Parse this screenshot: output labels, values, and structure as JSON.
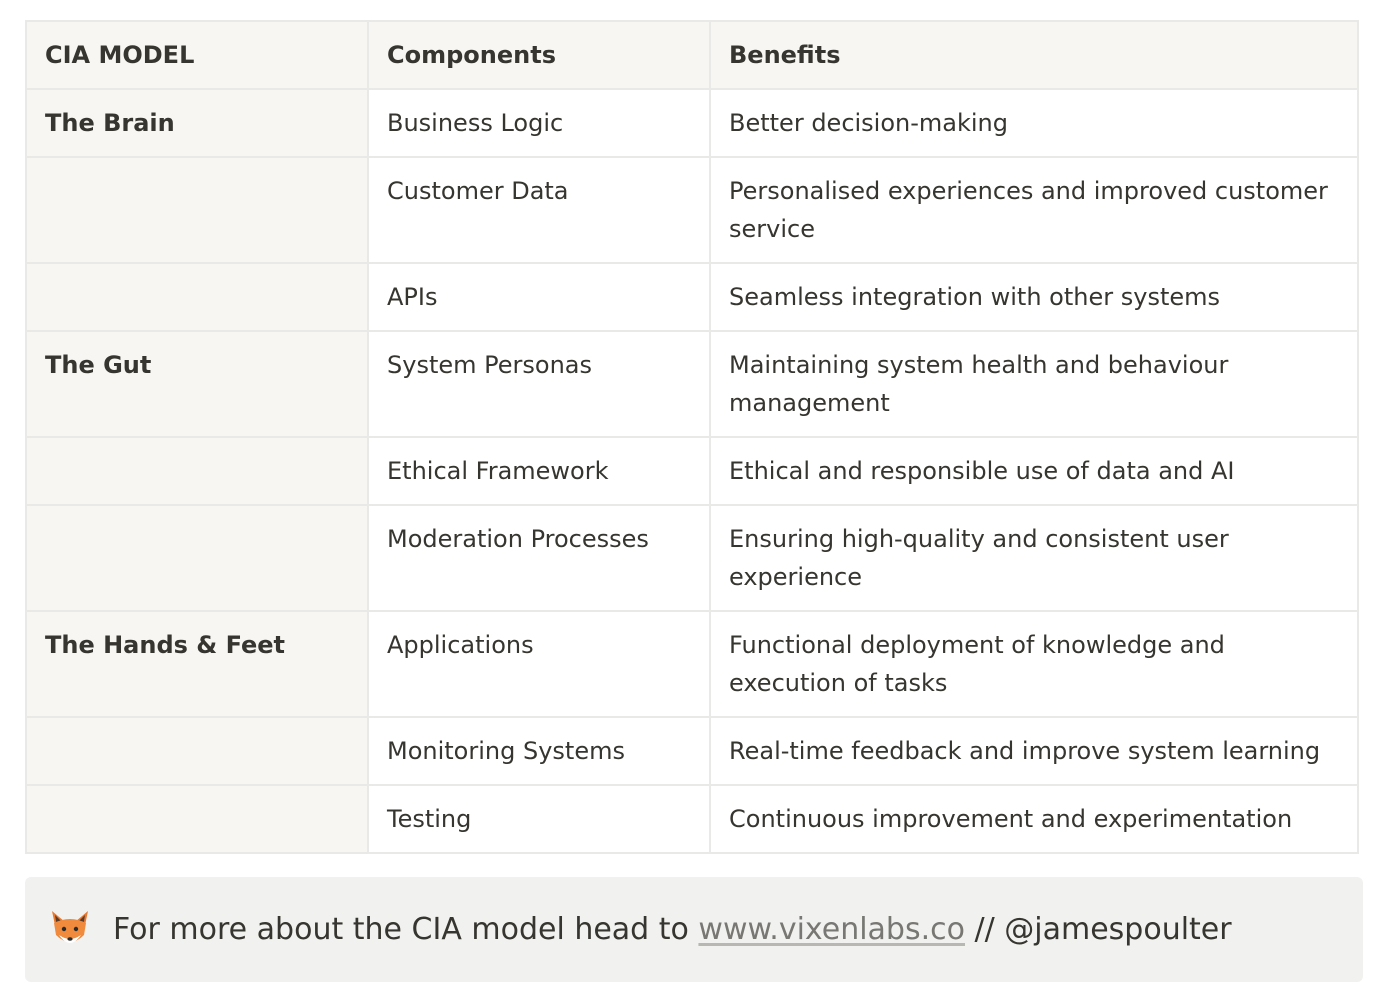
{
  "table": {
    "headers": [
      "CIA MODEL",
      "Components",
      "Benefits"
    ],
    "rows": [
      {
        "model": "The Brain",
        "component": "Business Logic",
        "benefit": "Better decision-making"
      },
      {
        "model": "",
        "component": "Customer Data",
        "benefit": "Personalised experiences and improved customer service"
      },
      {
        "model": "",
        "component": "APIs",
        "benefit": "Seamless integration with other systems"
      },
      {
        "model": "The Gut",
        "component": "System Personas",
        "benefit": "Maintaining system health and behaviour management"
      },
      {
        "model": "",
        "component": "Ethical Framework",
        "benefit": "Ethical and responsible use of data and AI"
      },
      {
        "model": "",
        "component": "Moderation Processes",
        "benefit": "Ensuring high-quality and consistent user experience"
      },
      {
        "model": "The Hands & Feet",
        "component": "Applications",
        "benefit": "Functional deployment of knowledge and execution of tasks"
      },
      {
        "model": "",
        "component": "Monitoring Systems",
        "benefit": "Real-time feedback and improve system learning"
      },
      {
        "model": "",
        "component": "Testing",
        "benefit": "Continuous improvement and experimentation"
      }
    ]
  },
  "callout": {
    "icon": "fox-icon",
    "prefix": "For more about the CIA model head to ",
    "link_text": "www.vixenlabs.co",
    "suffix": " // @jamespoulter"
  },
  "colors": {
    "header_bg": "#f7f6f3",
    "border": "#e9e9e7",
    "text": "#37352f",
    "callout_bg": "#f1f1ef",
    "link": "#787774"
  }
}
